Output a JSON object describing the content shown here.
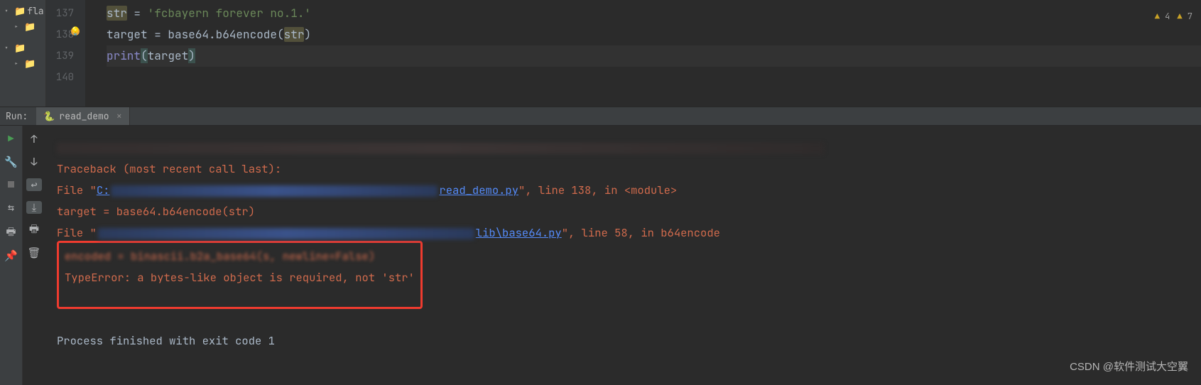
{
  "editor": {
    "tree": {
      "item1": "fla",
      "chev1": "▾",
      "chev2": "▸",
      "chev3": "▾",
      "chev4": "▸"
    },
    "gutter": {
      "l1": "137",
      "l2": "138",
      "l3": "139",
      "l4": "140"
    },
    "code": {
      "l1_var": "str",
      "l1_eq": " = ",
      "l1_str": "'fcbayern forever no.1.'",
      "l2_var": "target",
      "l2_eq": " = base64.b64encode(",
      "l2_arg": "str",
      "l2_close": ")",
      "l3_fn": "print",
      "l3_open": "(",
      "l3_arg": "target",
      "l3_close": ")"
    },
    "warnings": {
      "w1": " 4",
      "w2": " 7"
    }
  },
  "run": {
    "label": "Run:",
    "tab": "read_demo",
    "close": "×"
  },
  "console": {
    "traceback": "Traceback (most recent call last):",
    "file1_pre": "  File \"",
    "file1_link": "C:",
    "file1_post": "read_demo.py",
    "file1_tail": "\", line 138, in <module>",
    "tb_line1": "    target = base64.b64encode(str)",
    "file2_pre": "  File \"",
    "file2_post": "lib\\base64.py",
    "file2_tail": "\", line 58, in b64encode",
    "tb_line2_a": "    encoded = binascii.b2a_base64(s, ",
    "tb_line2_b": "newline=False",
    "tb_line2_c": ")",
    "error": "TypeError: a bytes-like object is required, not 'str'",
    "exit": "Process finished with exit code 1",
    "watermark": "CSDN @软件测试大空翼"
  },
  "icons": {
    "folder": "📁",
    "play": "▶",
    "wrench": "🔧",
    "stop": "■",
    "layout": "⇆",
    "wrap": "↩",
    "print": "🖶",
    "pin": "📌",
    "trash": "🗑",
    "up": "↑",
    "down": "↓",
    "python": "🐍",
    "tri": "▲"
  }
}
